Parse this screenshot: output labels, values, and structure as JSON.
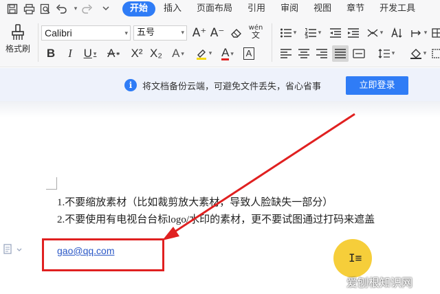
{
  "quick_access": [
    {
      "name": "save-icon",
      "glyph": "🖫"
    },
    {
      "name": "print-icon",
      "glyph": "⎙"
    },
    {
      "name": "print-preview-icon",
      "glyph": "🔍"
    },
    {
      "name": "undo-icon",
      "glyph": "↶"
    },
    {
      "name": "redo-icon",
      "glyph": "↷"
    },
    {
      "name": "customize-icon",
      "glyph": "▾"
    }
  ],
  "tabs": [
    "开始",
    "插入",
    "页面布局",
    "引用",
    "审阅",
    "视图",
    "章节",
    "开发工具"
  ],
  "active_tab": "开始",
  "ribbon": {
    "format_painter_label": "格式刷",
    "font_name": "Calibri",
    "font_size": "五号",
    "wen_label": "wén",
    "bold": "B",
    "italic": "I",
    "underline": "U",
    "strike": "A",
    "superscript": "X²",
    "subscript": "X₂",
    "text_effect": "A",
    "font_color": "A",
    "char_border": "A",
    "grow_font": "A⁺",
    "shrink_font": "A⁻"
  },
  "notice": {
    "text": "将文档备份云端，可避免文件丢失，省心省事",
    "button": "立即登录"
  },
  "document": {
    "line1": "1.不要缩放素材（比如裁剪放大素材，导致人脸缺失一部分）",
    "line2": "2.不要使用有电视台台标logo/水印的素材，更不要试图通过打码来遮盖",
    "email": "gao@qq.com"
  },
  "watermark": "爱刨根知识网",
  "colors": {
    "accent": "#2f7cf6",
    "highlight_box": "#e02020",
    "link": "#2a57c6",
    "cursor_halo": "#f5c518"
  }
}
